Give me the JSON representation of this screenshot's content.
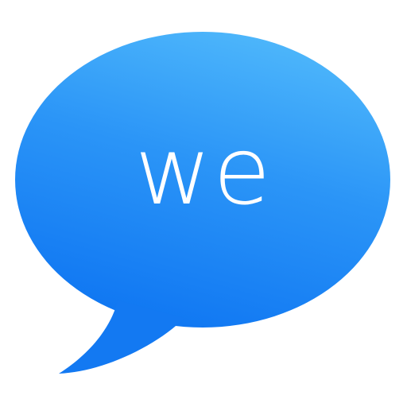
{
  "icon": {
    "name": "speech-bubble-icon",
    "text": "we",
    "colors": {
      "gradient_top": "#4fb8fb",
      "gradient_bottom": "#0f76f2",
      "text": "#ffffff",
      "background": "#ffffff"
    }
  }
}
